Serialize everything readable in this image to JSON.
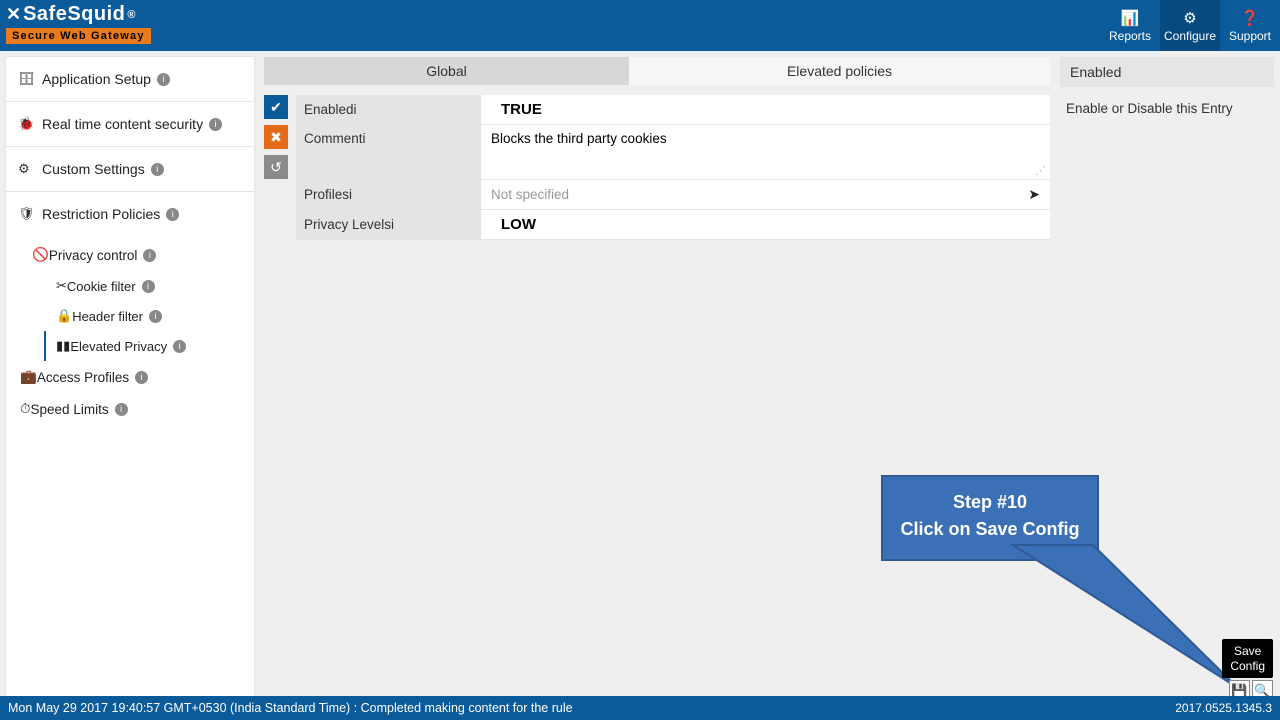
{
  "brand": {
    "name": "SafeSquid",
    "reg": "®",
    "tagline": "Secure Web Gateway"
  },
  "topnav": {
    "reports": "Reports",
    "configure": "Configure",
    "support": "Support"
  },
  "sidebar": {
    "items": [
      {
        "label": "Application Setup"
      },
      {
        "label": "Real time content security"
      },
      {
        "label": "Custom Settings"
      },
      {
        "label": "Restriction Policies"
      }
    ],
    "privacy": {
      "label": "Privacy control"
    },
    "privacy_children": [
      {
        "label": "Cookie filter"
      },
      {
        "label": "Header filter"
      },
      {
        "label": "Elevated Privacy"
      }
    ],
    "access_profiles": "Access Profiles",
    "speed_limits": "Speed Limits"
  },
  "tabs": {
    "global": "Global",
    "elevated": "Elevated policies"
  },
  "form": {
    "enabled_label": "Enabled",
    "enabled_value": "TRUE",
    "comment_label": "Comment",
    "comment_value": "Blocks the third party cookies",
    "profiles_label": "Profiles",
    "profiles_value": "Not specified",
    "privacy_levels_label": "Privacy Levels",
    "privacy_levels_value": "LOW"
  },
  "rightpane": {
    "heading": "Enabled",
    "body": "Enable or Disable this Entry"
  },
  "callout": {
    "line1": "Step #10",
    "line2": "Click on Save Config"
  },
  "tooltip": {
    "line1": "Save",
    "line2": "Config"
  },
  "status": {
    "left": "Mon May 29 2017 19:40:57 GMT+0530 (India Standard Time) : Completed making content for the rule",
    "version": "2017.0525.1345.3"
  }
}
